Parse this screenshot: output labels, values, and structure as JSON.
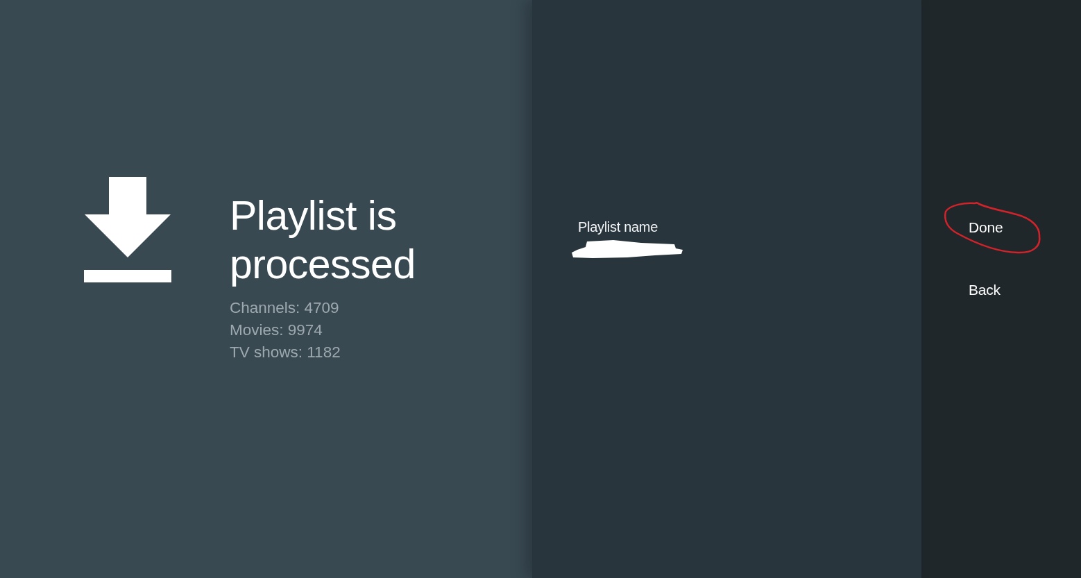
{
  "status": {
    "title": "Playlist is processed",
    "stats": [
      "Channels: 4709",
      "Movies: 9974",
      "TV shows: 1182"
    ]
  },
  "form": {
    "label": "Playlist name",
    "redacted": true
  },
  "actions": [
    {
      "label": "Done",
      "circled": true
    },
    {
      "label": "Back",
      "circled": false
    }
  ]
}
